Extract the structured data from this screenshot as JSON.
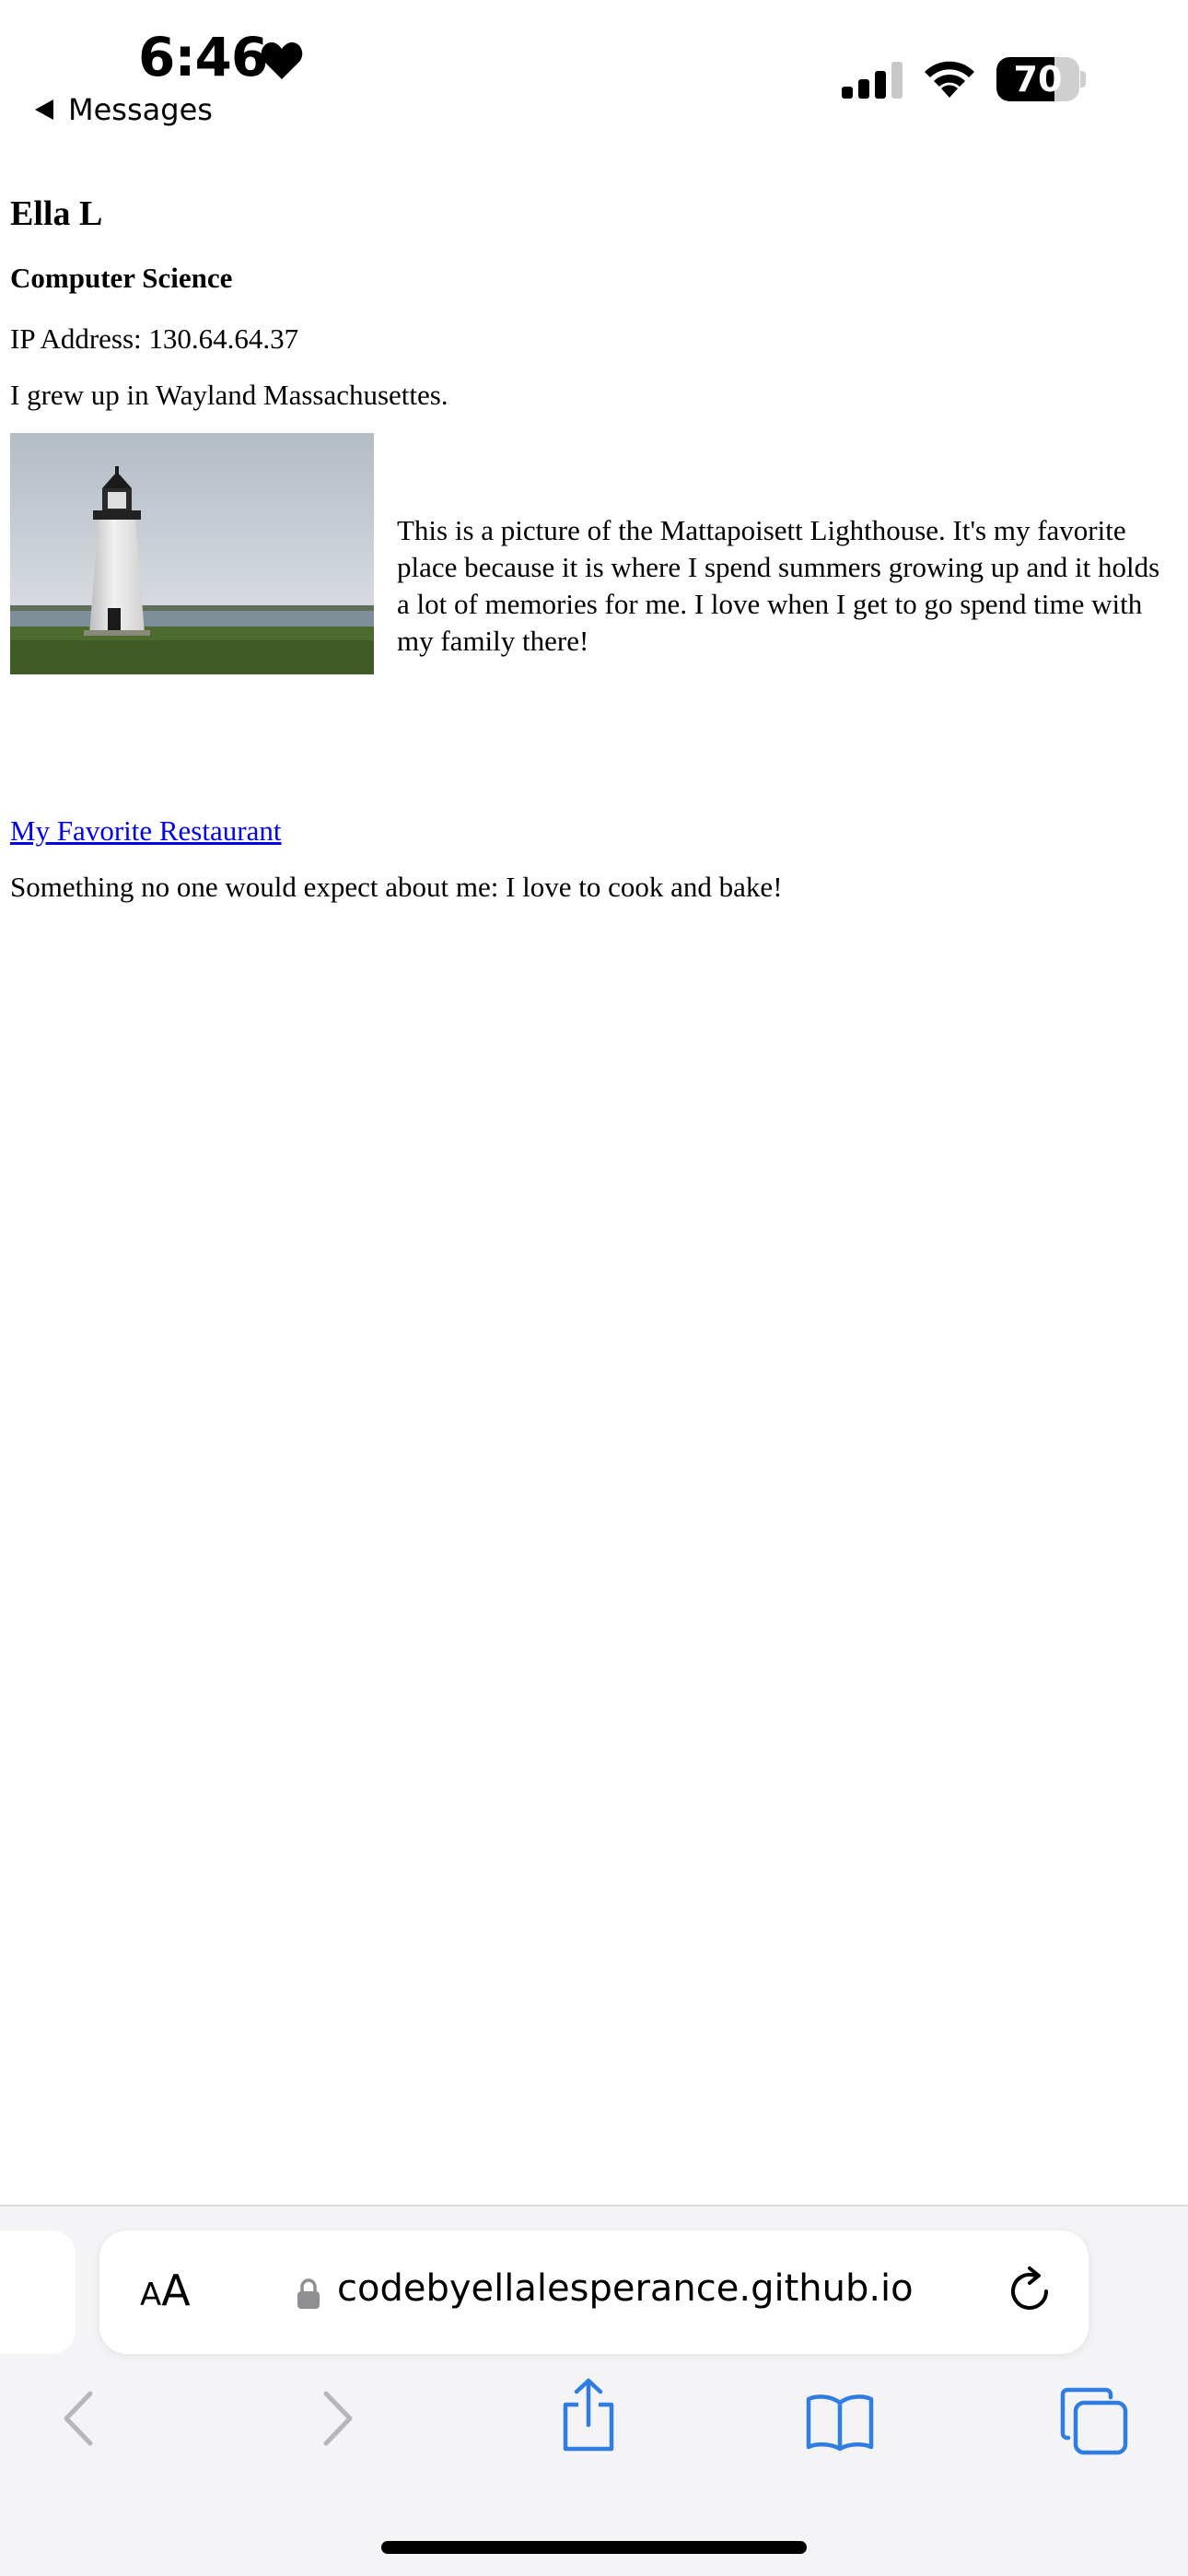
{
  "status_bar": {
    "time": "6:46",
    "back_app": "Messages",
    "battery_percent": "70",
    "battery_level": 0.7
  },
  "page": {
    "name": "Ella L",
    "major": "Computer Science",
    "ip_address": "IP Address: 130.64.64.37",
    "hometown": "I grew up in Wayland Massachusettes.",
    "photo_caption": "This is a picture of the Mattapoisett Lighthouse. It's my favorite place because it is where I spend summers growing up and it holds a lot of memories for me. I love when I get to go spend time with my family there!",
    "restaurant_link": "My Favorite Restaurant",
    "fun_fact": "Something no one would expect about me: I love to cook and bake!"
  },
  "browser": {
    "text_size_small": "A",
    "text_size_big": "A",
    "url": "codebyellalesperance.github.io"
  },
  "colors": {
    "link": "#0000ee",
    "toolbar_accent": "#2f7de1",
    "toolbar_disabled": "#b6b6bb",
    "chrome_bg": "#f4f4f6"
  },
  "icons": {
    "heart": "heart-icon",
    "signal": "cellular-signal-icon",
    "wifi": "wifi-icon",
    "lock": "lock-icon",
    "reload": "reload-icon",
    "back": "chevron-left-icon",
    "forward": "chevron-right-icon",
    "share": "share-icon",
    "bookmarks": "book-icon",
    "tabs": "tabs-icon"
  }
}
